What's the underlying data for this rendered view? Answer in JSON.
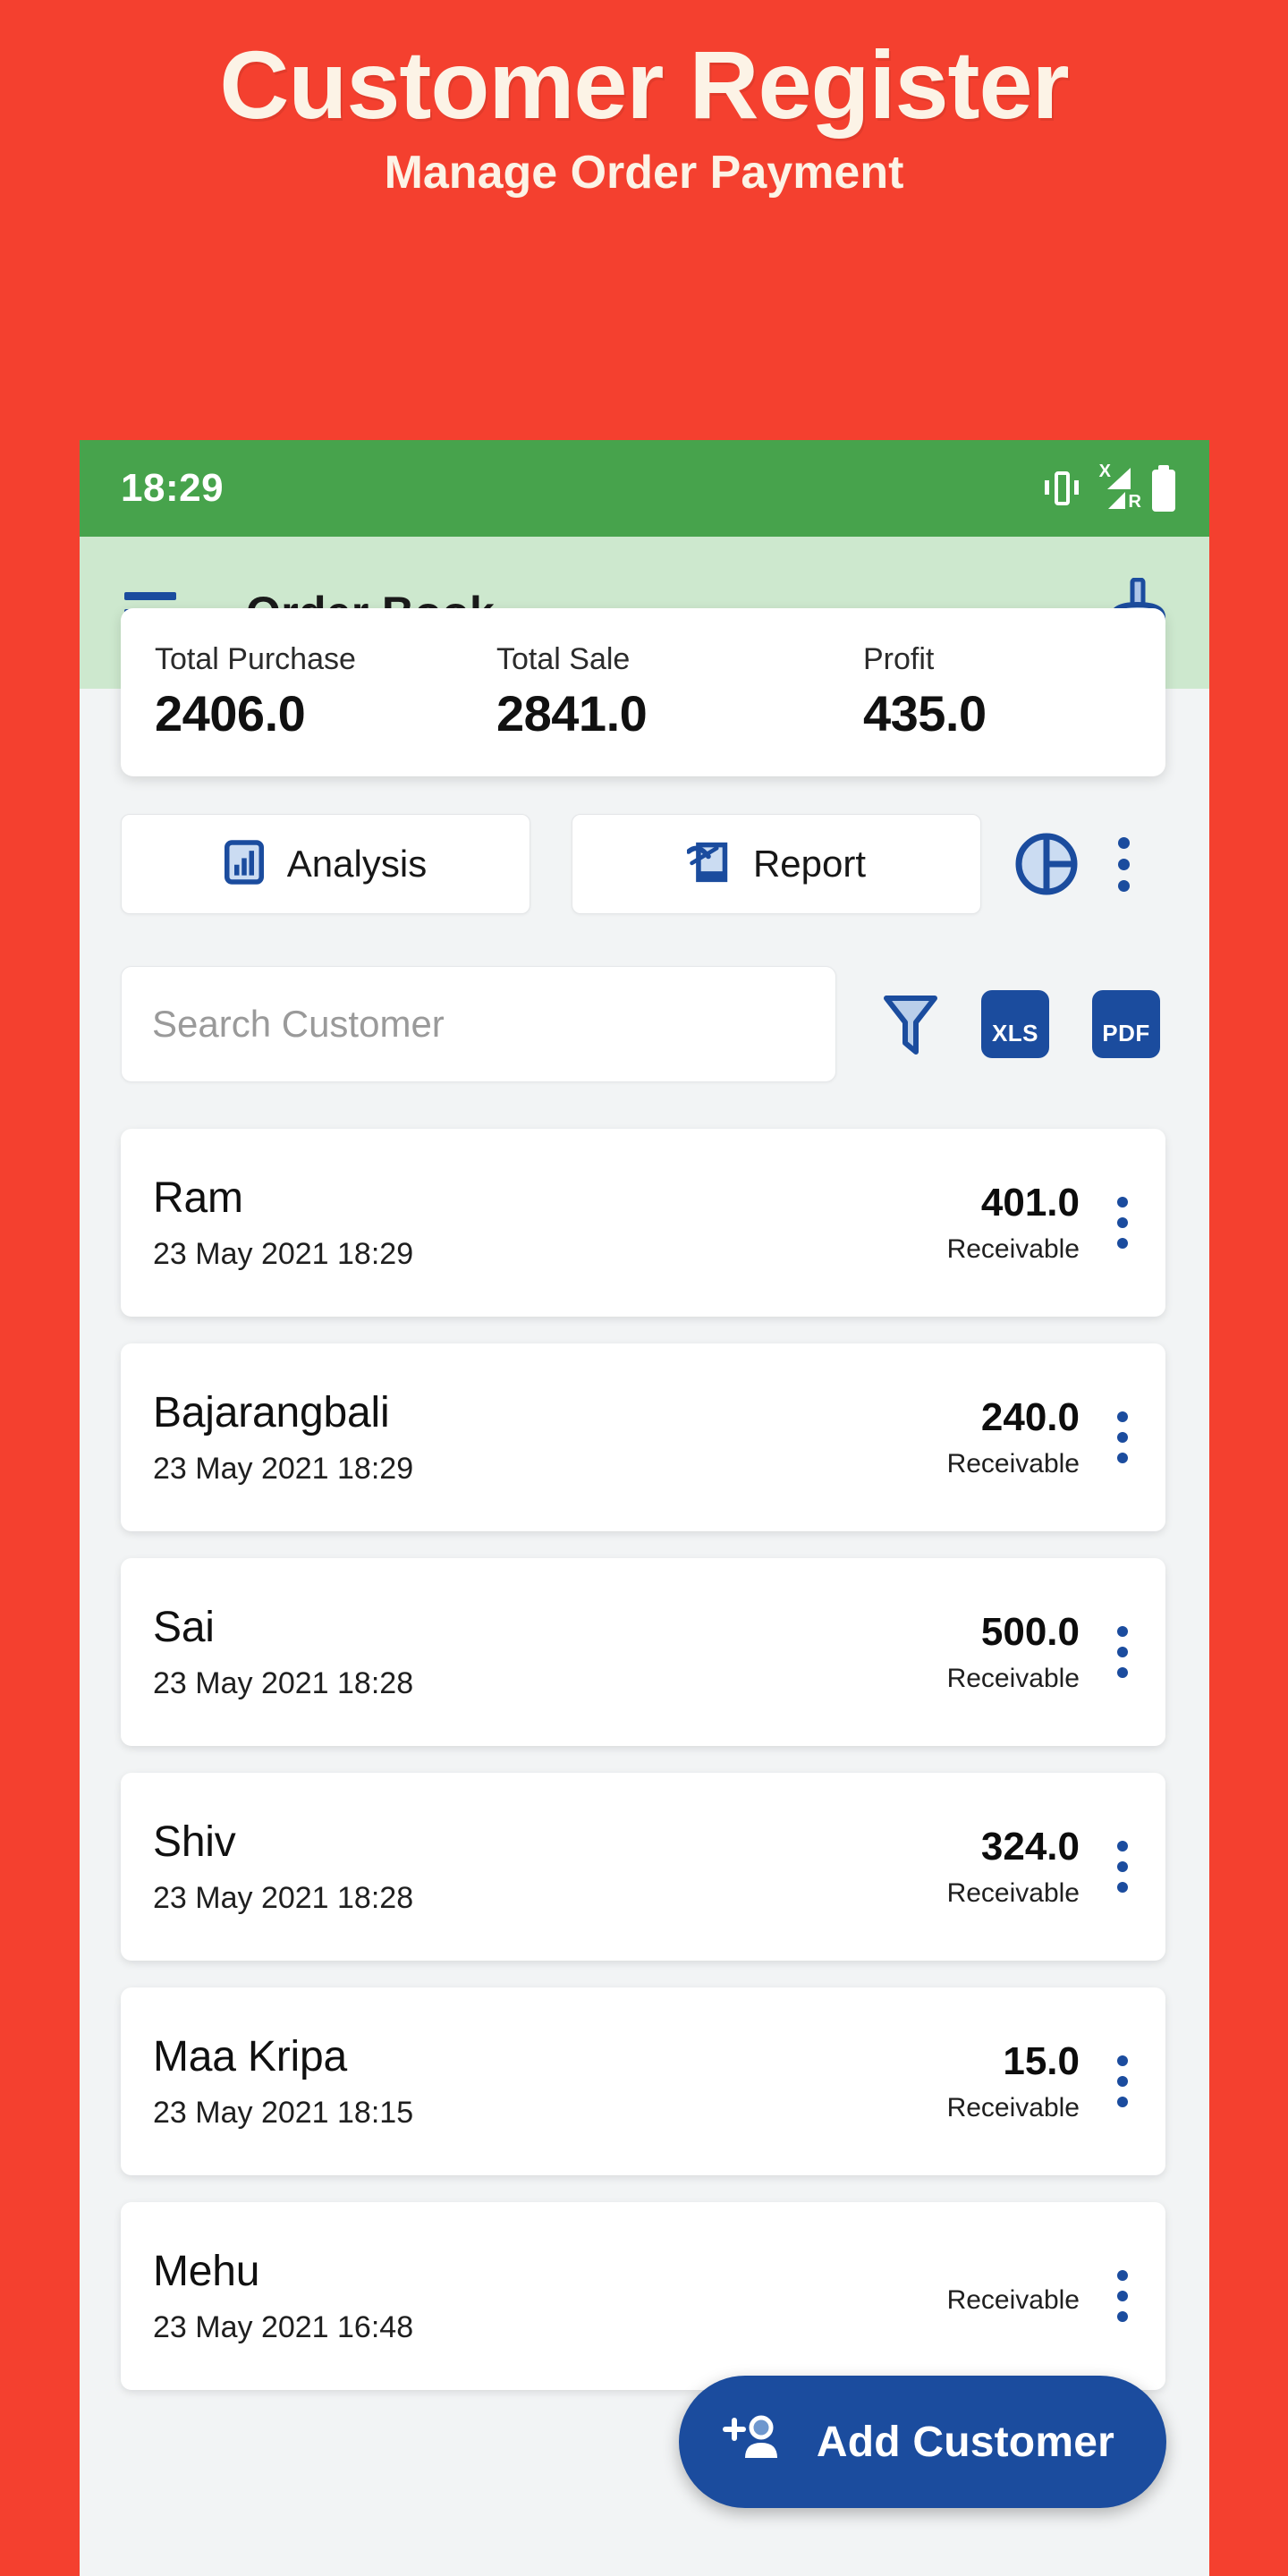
{
  "promo": {
    "title": "Customer Register",
    "subtitle": "Manage Order Payment",
    "bg_color": "#F4402F",
    "text_color": "#FCF3E6"
  },
  "status_bar": {
    "time": "18:29",
    "bg_color": "#47A34C",
    "icons": [
      "vibrate-icon",
      "signal-no-service-roaming-icon",
      "battery-icon"
    ],
    "signal_x_label": "X",
    "signal_r_label": "R"
  },
  "app_bar": {
    "title": "Order Book",
    "bg_color": "#CDE8CE",
    "menu_icon": "hamburger-icon",
    "action_icon": "broom-clean-icon",
    "accent_color": "#1B4C9E"
  },
  "summary": {
    "items": [
      {
        "label": "Total Purchase",
        "value": "2406.0"
      },
      {
        "label": "Total Sale",
        "value": "2841.0"
      },
      {
        "label": "Profit",
        "value": "435.0"
      }
    ]
  },
  "actions": {
    "analysis_label": "Analysis",
    "analysis_icon": "bar-chart-icon",
    "report_label": "Report",
    "report_icon": "report-document-pen-icon",
    "pie_icon": "pie-chart-icon",
    "overflow_icon": "more-vertical-icon"
  },
  "search": {
    "placeholder": "Search Customer",
    "value": "",
    "filter_icon": "funnel-filter-icon",
    "xls_label": "XLS",
    "pdf_label": "PDF"
  },
  "customers": [
    {
      "name": "Ram",
      "date": "23 May 2021 18:29",
      "amount": "401.0",
      "status": "Receivable"
    },
    {
      "name": "Bajarangbali",
      "date": "23 May 2021 18:29",
      "amount": "240.0",
      "status": "Receivable"
    },
    {
      "name": "Sai",
      "date": "23 May 2021 18:28",
      "amount": "500.0",
      "status": "Receivable"
    },
    {
      "name": "Shiv",
      "date": "23 May 2021 18:28",
      "amount": "324.0",
      "status": "Receivable"
    },
    {
      "name": "Maa Kripa",
      "date": "23 May 2021 18:15",
      "amount": "15.0",
      "status": "Receivable"
    },
    {
      "name": "Mehu",
      "date": "23 May 2021 16:48",
      "amount": "",
      "status": "Receivable"
    }
  ],
  "fab": {
    "label": "Add Customer",
    "icon": "person-add-icon",
    "bg_color": "#1B4C9E"
  }
}
